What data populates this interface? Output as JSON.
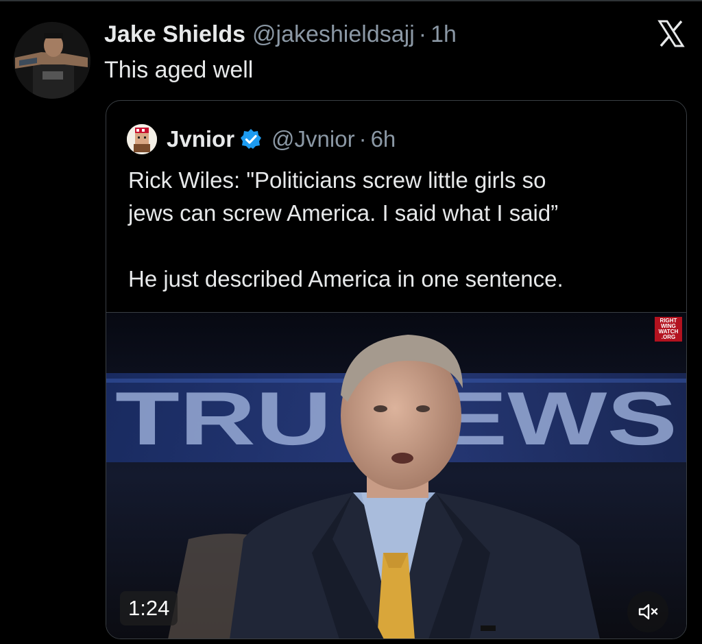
{
  "tweet": {
    "author_name": "Jake Shields",
    "author_handle": "@jakeshieldsajj",
    "separator": "·",
    "time": "1h",
    "text": "This aged well"
  },
  "quoted_tweet": {
    "author_name": "Jvnior",
    "author_handle": "@Jvnior",
    "separator": "·",
    "time": "6h",
    "paragraphs": [
      "Rick Wiles: \"Politicians screw little girls so\njews can screw America. I said what I said”",
      "He just described America in one sentence."
    ],
    "video": {
      "duration": "1:24",
      "background_text": "TRU NEWS",
      "watermark": [
        "RIGHT",
        "WING",
        "WATCH",
        ".ORG"
      ]
    }
  },
  "icons": {
    "brand": "x-logo-icon",
    "verified": "verified-badge-icon",
    "mute": "speaker-muted-icon"
  },
  "colors": {
    "background": "#000000",
    "primary_text": "#e7e9ea",
    "secondary_text": "#8b98a5",
    "border": "#3a3f44",
    "verified_blue": "#1d9bf0",
    "tie": "#d9a63a"
  }
}
